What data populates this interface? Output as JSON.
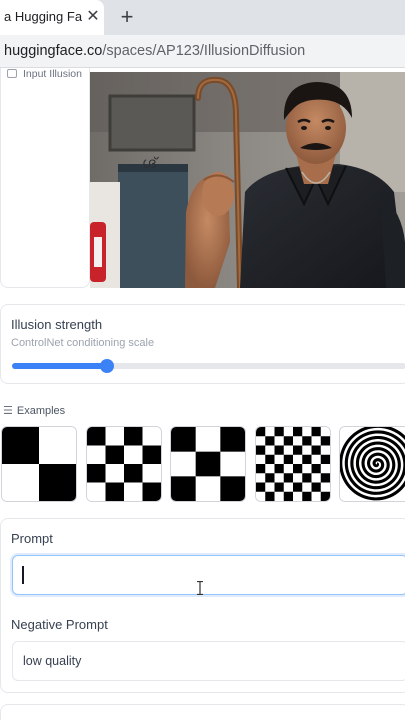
{
  "browser": {
    "tab_title": "a Hugging Face",
    "close_glyph": "✕",
    "new_tab_glyph": "+",
    "url_host": "huggingface.co",
    "url_path": "/spaces/AP123/IllusionDiffusion"
  },
  "input_illusion": {
    "label": "Input Illusion",
    "icon": "image-icon"
  },
  "illusion_strength": {
    "label": "Illusion strength",
    "info": "ControlNet conditioning scale",
    "value_fraction": 0.24,
    "accent_color": "#3b82f6"
  },
  "examples": {
    "label": "Examples",
    "icon": "list-icon",
    "items": [
      {
        "name": "checker-2x2",
        "pattern": "checker",
        "cells": 2
      },
      {
        "name": "checker-4x4",
        "pattern": "checker",
        "cells": 4
      },
      {
        "name": "checker-3x3",
        "pattern": "checker",
        "cells": 3
      },
      {
        "name": "checker-8x8",
        "pattern": "checker",
        "cells": 8
      },
      {
        "name": "spiral",
        "pattern": "spiral",
        "cells": 0
      }
    ]
  },
  "prompt": {
    "label": "Prompt",
    "value": "",
    "placeholder": ""
  },
  "negative_prompt": {
    "label": "Negative Prompt",
    "value": "low quality"
  }
}
